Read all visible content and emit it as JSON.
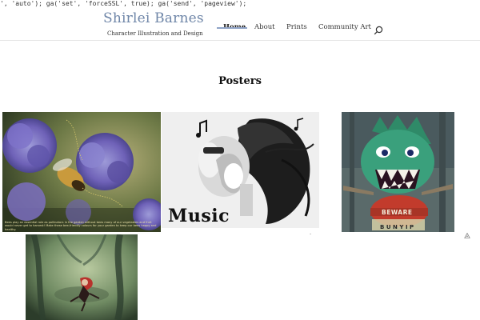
{
  "leak_text": "', 'auto'); ga('set', 'forceSSL', true); ga('send', 'pageview');",
  "site": {
    "title": "Shirlei Barnes",
    "tagline": "Character Illustration and Design"
  },
  "nav": {
    "items": [
      {
        "label": "Home",
        "active": true
      },
      {
        "label": "About",
        "active": false
      },
      {
        "label": "Prints",
        "active": false
      },
      {
        "label": "Community Art",
        "active": false
      }
    ],
    "search_icon": "search-icon"
  },
  "page": {
    "title": "Posters"
  },
  "gallery": {
    "bee_caption": "Bees play an essential role as pollinators in the garden without bees many of our vegetables and fruit would never get to harvest! Make these bee-friendly colours for your garden to keep our bees happy and healthy.",
    "music_title": "Music",
    "bunyip_sign": "BEWARE",
    "bunyip_name": "BUNYIP",
    "pin_icon": "pin-icon"
  },
  "colors": {
    "title_blue": "#6f86a8",
    "nav_active_underline": "#8fa3c7"
  }
}
